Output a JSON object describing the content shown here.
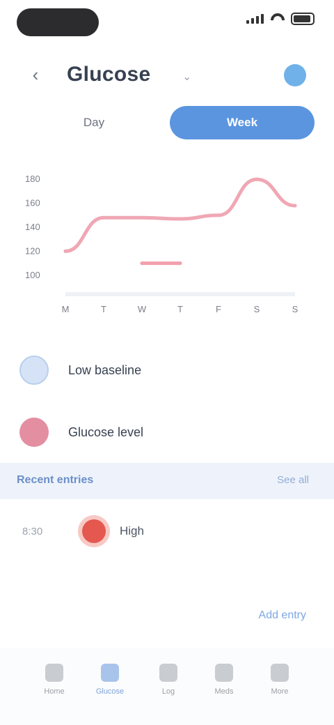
{
  "status_bar": {
    "time": "",
    "signal_icon": "signal-icon",
    "wifi_icon": "wifi-icon",
    "battery_icon": "battery-icon"
  },
  "header": {
    "back_icon": "chevron-left-icon",
    "back_glyph": "‹",
    "title": "Glucose",
    "title_chevron": "⌄",
    "action_icon": "info-icon"
  },
  "segmented": {
    "left_label": "Day",
    "right_label": "Week"
  },
  "chart_data": {
    "type": "line",
    "y_ticks": [
      "180",
      "160",
      "140",
      "120",
      "100"
    ],
    "x_ticks": [
      "M",
      "T",
      "W",
      "T",
      "F",
      "S",
      "S"
    ],
    "ylim": [
      90,
      190
    ],
    "series": [
      {
        "color": "#f0a7b4",
        "x": [
          "M",
          "T",
          "W",
          "T",
          "F",
          "S",
          "S"
        ],
        "values": [
          120,
          148,
          148,
          147,
          150,
          180,
          158
        ]
      },
      {
        "color": "#f2a0ad",
        "x": [
          "W",
          "T"
        ],
        "values": [
          110,
          110
        ]
      }
    ],
    "grid": false
  },
  "legend": [
    {
      "label": "Low baseline",
      "color": "#d6e3f6"
    },
    {
      "label": "Glucose level",
      "color": "#e38ea1"
    }
  ],
  "section": {
    "title": "Recent entries",
    "link": "See all"
  },
  "entries": [
    {
      "time": "8:30",
      "label": "High",
      "color": "#e4584f"
    }
  ],
  "more_link": "Add entry",
  "tabbar": {
    "tabs": [
      {
        "label": "Home",
        "icon": "home-icon",
        "active": false
      },
      {
        "label": "Glucose",
        "icon": "chart-icon",
        "active": true
      },
      {
        "label": "Log",
        "icon": "plus-icon",
        "active": false
      },
      {
        "label": "Meds",
        "icon": "pill-icon",
        "active": false
      },
      {
        "label": "More",
        "icon": "menu-icon",
        "active": false
      }
    ]
  },
  "colors": {
    "accent": "#5b95e0",
    "line": "#f0a7b4",
    "alert": "#e4584f"
  }
}
